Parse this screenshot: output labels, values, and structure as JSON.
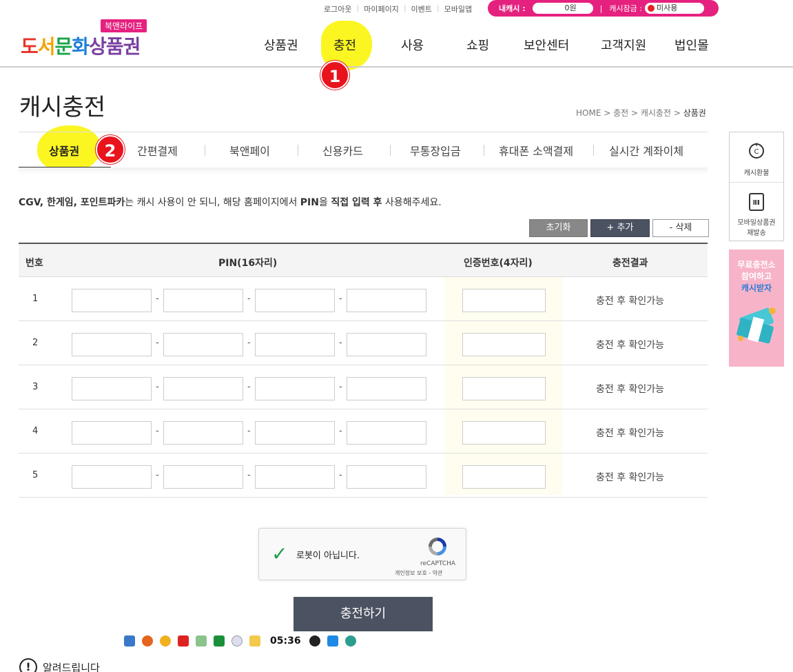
{
  "util": {
    "links": [
      "로그아웃",
      "마이페이지",
      "이벤트",
      "모바일앱"
    ],
    "my_cash_label": "내캐시 :",
    "my_cash_value": "0원",
    "cash_lock_label": "캐시잠금 :",
    "cash_lock_value": "미사용"
  },
  "logo": {
    "badge": "북앤라이프",
    "text_parts": [
      "도",
      "서",
      "문",
      "화",
      "상품권"
    ]
  },
  "nav": [
    "상품권",
    "충전",
    "사용",
    "쇼핑",
    "보안센터",
    "고객지원",
    "법인몰"
  ],
  "annotations": [
    "1",
    "2"
  ],
  "page_title": "캐시충전",
  "breadcrumb": {
    "path": "HOME > 충전 > 캐시충전 > ",
    "current": "상품권"
  },
  "tabs": [
    "상품권",
    "간편결제",
    "북앤페이",
    "신용카드",
    "무통장입금",
    "휴대폰 소액결제",
    "실시간 계좌이체"
  ],
  "notice": {
    "bold1": "CGV, 한게임, 포인트파카",
    "text1": "는 캐시 사용이 안 되니, 해당 홈페이지에서 ",
    "bold2": "PIN",
    "text2": "을 ",
    "bold3": "직접 입력 후",
    "text3": " 사용해주세요."
  },
  "buttons": {
    "reset": "초기화",
    "add": "+ 추가",
    "delete": "- 삭제"
  },
  "table": {
    "headers": [
      "번호",
      "PIN(16자리)",
      "인증번호(4자리)",
      "충전결과"
    ],
    "rows": [
      {
        "num": "1",
        "result": "충전 후 확인가능"
      },
      {
        "num": "2",
        "result": "충전 후 확인가능"
      },
      {
        "num": "3",
        "result": "충전 후 확인가능"
      },
      {
        "num": "4",
        "result": "충전 후 확인가능"
      },
      {
        "num": "5",
        "result": "충전 후 확인가능"
      }
    ],
    "dash": "-"
  },
  "captcha": {
    "label": "로봇이 아닙니다.",
    "brand": "reCAPTCHA",
    "terms": "개인정보 보호 - 약관"
  },
  "submit_label": "충전하기",
  "tray_time": "05:36",
  "info_title": "알려드립니다",
  "side": {
    "item1": "캐시환불",
    "item2_line1": "모바일상품권",
    "item2_line2": "재발송",
    "banner_line1": "무료충전소",
    "banner_line2": "참여하고",
    "banner_line3": "캐시받자"
  }
}
